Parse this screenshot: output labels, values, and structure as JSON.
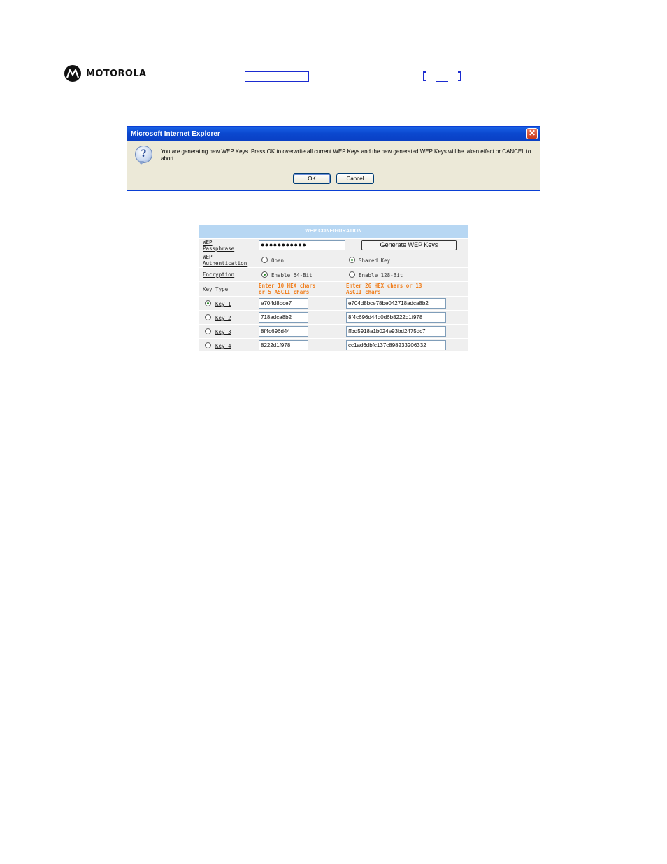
{
  "header": {
    "brand": "MOTOROLA",
    "logo_icon": "motorola-batwing-logo"
  },
  "dialog": {
    "title": "Microsoft Internet Explorer",
    "message": "You are generating new WEP Keys.  Press OK to overwrite all current WEP Keys and the new generated WEP Keys will be taken effect or CANCEL to abort.",
    "ok_label": "OK",
    "cancel_label": "Cancel",
    "icon": "question-icon"
  },
  "wep": {
    "title": "WEP CONFIGURATION",
    "passphrase_label_1": "WEP",
    "passphrase_label_2": "Passphrase",
    "passphrase_value": "●●●●●●●●●●●",
    "generate_label": "Generate WEP Keys",
    "auth_label_1": "WEP",
    "auth_label_2": "Authentication",
    "auth_open": "Open",
    "auth_shared": "Shared Key",
    "encryption_label": "Encryption",
    "enc_64": "Enable 64-Bit",
    "enc_128": "Enable 128-Bit",
    "key_type_label": "Key Type",
    "hint_64_1": "Enter 10 HEX chars",
    "hint_64_2": "or 5 ASCII chars",
    "hint_128_1": "Enter 26 HEX chars or 13",
    "hint_128_2": "ASCII chars",
    "keys": [
      {
        "label": "Key 1",
        "k64": "e704d8bce7",
        "k128": "e704d8bce78be042718adca8b2",
        "selected": true
      },
      {
        "label": "Key 2",
        "k64": "718adca8b2",
        "k128": "8f4c696d44d0d6b8222d1f978",
        "selected": false
      },
      {
        "label": "Key 3",
        "k64": "8f4c696d44",
        "k128": "ffbd5918a1b024e93bd2475dc7",
        "selected": false
      },
      {
        "label": "Key 4",
        "k64": "8222d1f978",
        "k128": "cc1ad6dbfc137c898233206332",
        "selected": false
      }
    ]
  }
}
